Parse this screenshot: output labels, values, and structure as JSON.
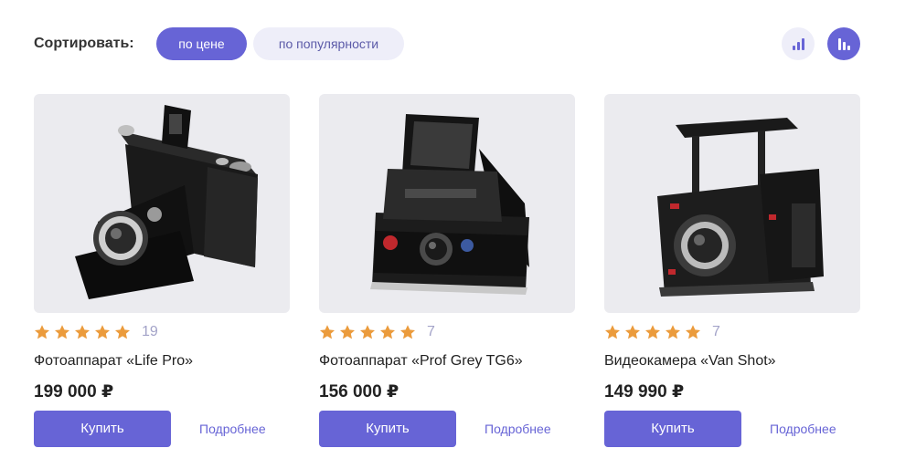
{
  "sort": {
    "label": "Сортировать:",
    "options": [
      {
        "label": "по цене",
        "active": true
      },
      {
        "label": "по популярности",
        "active": false
      }
    ],
    "view_toggle_icons": [
      "bar-chart-ascending-icon",
      "bar-chart-descending-icon"
    ]
  },
  "colors": {
    "accent": "#6764d6",
    "accent_light": "#eeeef9",
    "star": "#eb9b3c",
    "muted": "#a3a3c8",
    "photo_bg": "#ebebef"
  },
  "products": [
    {
      "image_icon": "folding-camera-photo",
      "rating": 5,
      "reviews": "19",
      "title": "Фотоаппарат «Life Pro»",
      "price": "199 000 ₽",
      "buy_label": "Купить",
      "details_label": "Подробнее"
    },
    {
      "image_icon": "instant-camera-photo",
      "rating": 5,
      "reviews": "7",
      "title": "Фотоаппарат «Prof Grey TG6»",
      "price": "156 000 ₽",
      "buy_label": "Купить",
      "details_label": "Подробнее"
    },
    {
      "image_icon": "cinema-camera-photo",
      "rating": 5,
      "reviews": "7",
      "title": "Видеокамера «Van Shot»",
      "price": "149 990 ₽",
      "buy_label": "Купить",
      "details_label": "Подробнее"
    }
  ]
}
